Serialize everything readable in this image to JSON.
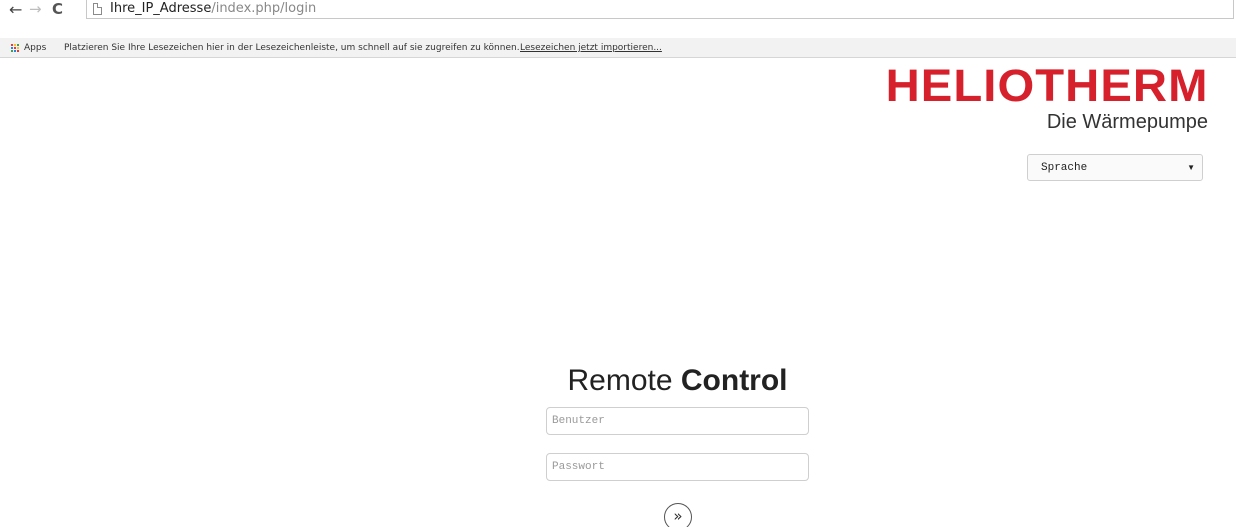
{
  "browser": {
    "url_host": "Ihre_IP_Adresse",
    "url_path": "/index.php/login",
    "back_icon": "←",
    "forward_icon": "→",
    "reload_icon": "C"
  },
  "bookmarks_bar": {
    "apps_label": "Apps",
    "info_text": "Platzieren Sie Ihre Lesezeichen hier in der Lesezeichenleiste, um schnell auf sie zugreifen zu können.",
    "import_link": "Lesezeichen jetzt importieren..."
  },
  "logo": {
    "title": "HELIOTHERM",
    "subtitle": "Die Wärmepumpe",
    "brand_color": "#d6202b"
  },
  "language_select": {
    "selected": "Sprache",
    "arrow": "▼"
  },
  "login": {
    "heading_light": "Remote",
    "heading_bold": "Control",
    "username_placeholder": "Benutzer",
    "password_placeholder": "Passwort",
    "submit_icon": "»"
  }
}
